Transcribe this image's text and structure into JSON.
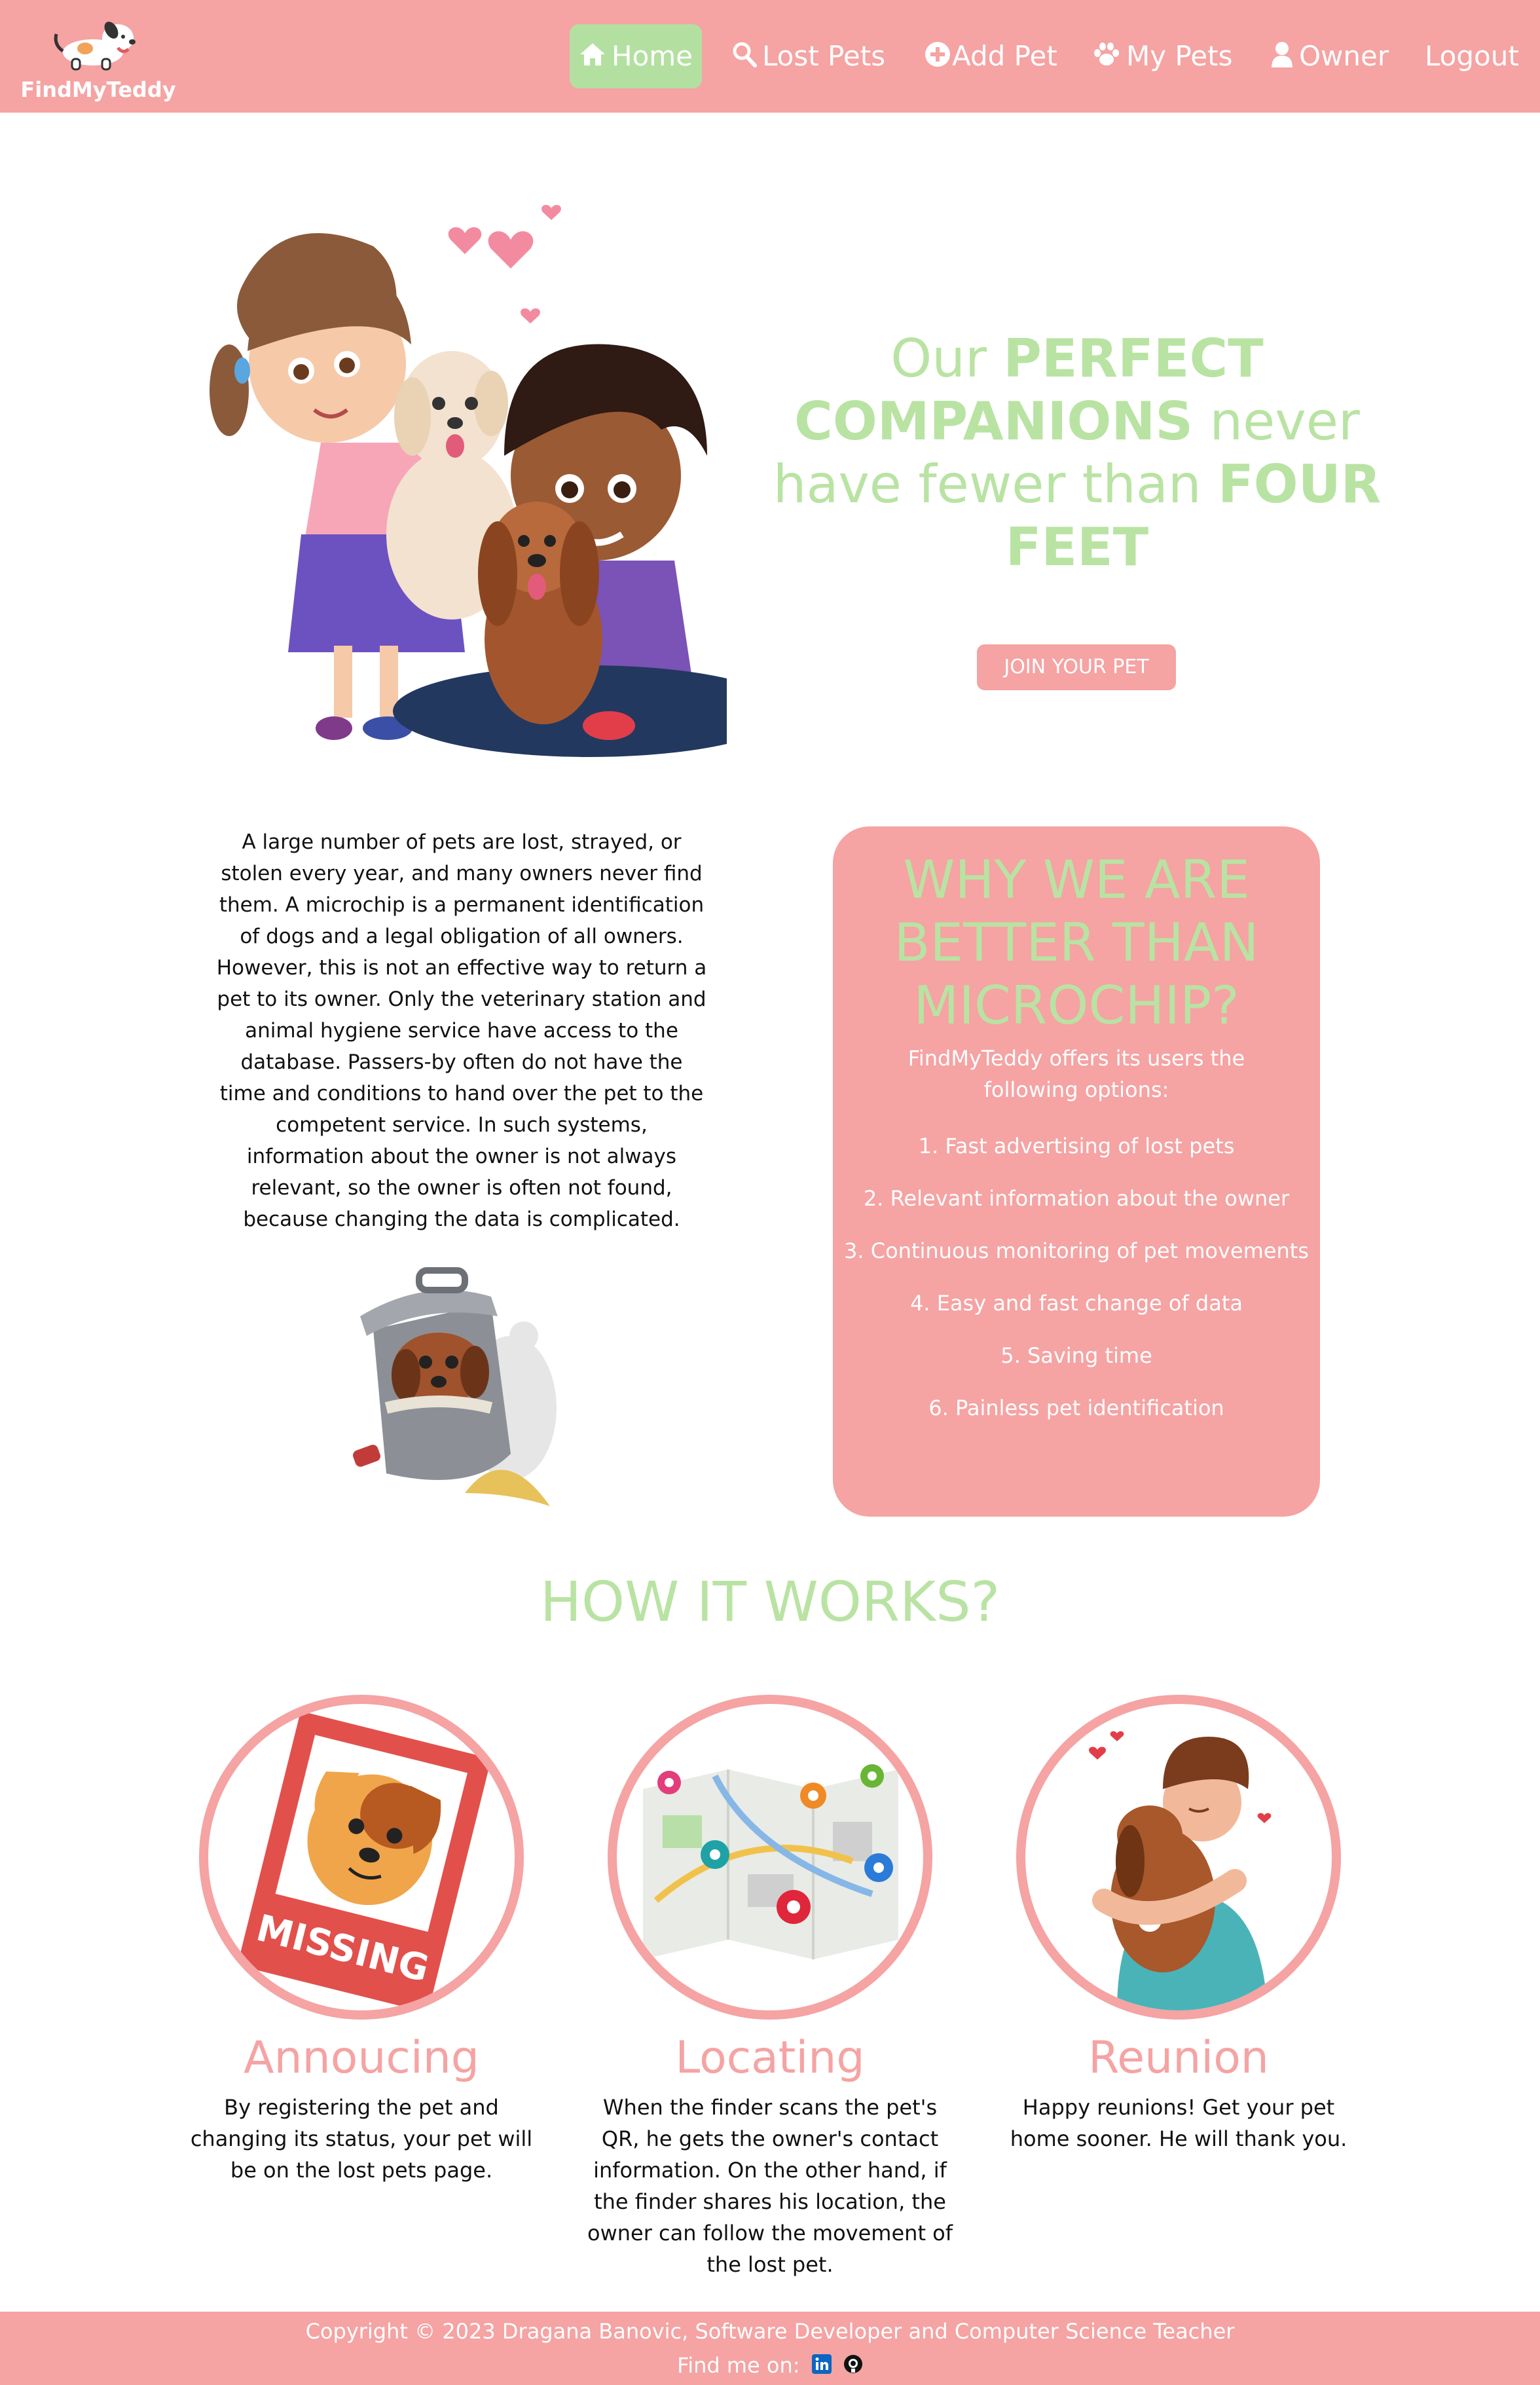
{
  "brand": {
    "name": "FindMyTeddy"
  },
  "nav": {
    "home": "Home",
    "lost_pets": "Lost Pets",
    "add_pet": "Add Pet",
    "my_pets": "My Pets",
    "owner": "Owner",
    "logout": "Logout"
  },
  "hero": {
    "line1_a": "Our ",
    "line1_b": "PERFECT",
    "line2_a": "COMPANIONS",
    "line2_b": " never",
    "line3_a": "have fewer than ",
    "line3_b": "FOUR",
    "line4": "FEET",
    "button": "JOIN YOUR PET"
  },
  "info": {
    "text": "A large number of pets are lost, strayed, or stolen every year, and many owners never find them. A microchip is a permanent identification of dogs and a legal obligation of all owners. However, this is not an effective way to return a pet to its owner. Only the veterinary station and animal hygiene service have access to the database. Passers-by often do not have the time and conditions to hand over the pet to the competent service. In such systems, information about the owner is not always relevant, so the owner is often not found, because changing the data is complicated."
  },
  "why": {
    "title_l1": "WHY WE ARE",
    "title_l2": "BETTER THAN",
    "title_l3": "MICROCHIP?",
    "intro": "FindMyTeddy offers its users the following options:",
    "items": [
      "1. Fast advertising of lost pets",
      "2. Relevant information about the owner",
      "3. Continuous monitoring of pet movements",
      "4. Easy and fast change of data",
      "5. Saving time",
      "6. Painless pet identification"
    ]
  },
  "how": {
    "title": "HOW IT WORKS?",
    "steps": [
      {
        "title": "Annoucing",
        "text": "By registering the pet and changing its status, your pet will be on the lost pets page.",
        "badge": "MISSING"
      },
      {
        "title": "Locating",
        "text": "When the finder scans the pet's QR, he gets the owner's contact information. On the other hand, if the finder shares his location, the owner can follow the movement of the lost pet."
      },
      {
        "title": "Reunion",
        "text": "Happy reunions! Get your pet home sooner. He will thank you."
      }
    ]
  },
  "footer": {
    "copyright": "Copyright © 2023 Dragana Banovic, Software Developer and Computer Science Teacher",
    "find_me": "Find me on:"
  },
  "colors": {
    "pink": "#f5a3a3",
    "green": "#b9e3a3",
    "nav_active": "#b3e0a0"
  },
  "icons": [
    "home-icon",
    "search-icon",
    "plus-circle-icon",
    "paw-icon",
    "user-icon",
    "linkedin-icon",
    "github-icon"
  ]
}
